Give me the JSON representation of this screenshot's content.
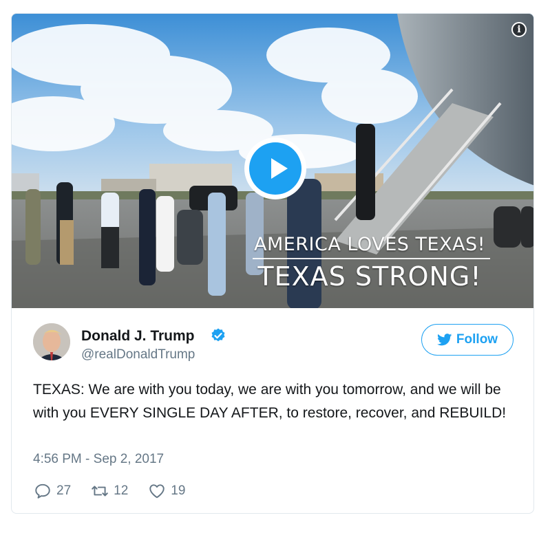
{
  "media": {
    "overlay_line1": "AMERICA LOVES TEXAS!",
    "overlay_line2": "TEXAS STRONG!",
    "info_label": "i"
  },
  "author": {
    "name": "Donald J. Trump",
    "handle": "@realDonaldTrump",
    "verified": true
  },
  "follow_label": "Follow",
  "tweet": {
    "text": "TEXAS: We are with you today, we are with you tomorrow, and we will be with you EVERY SINGLE DAY AFTER, to restore, recover, and REBUILD!",
    "timestamp": "4:56 PM - Sep 2, 2017"
  },
  "stats": {
    "replies": "27",
    "retweets": "12",
    "likes": "19"
  },
  "colors": {
    "accent": "#1da1f2",
    "secondary_text": "#657786",
    "primary_text": "#14171a",
    "border": "#e1e8ed"
  },
  "icons": {
    "reply": "reply-icon",
    "retweet": "retweet-icon",
    "like": "heart-icon",
    "verified": "verified-badge-icon",
    "bird": "twitter-bird-icon",
    "play": "play-icon",
    "info": "info-icon"
  }
}
